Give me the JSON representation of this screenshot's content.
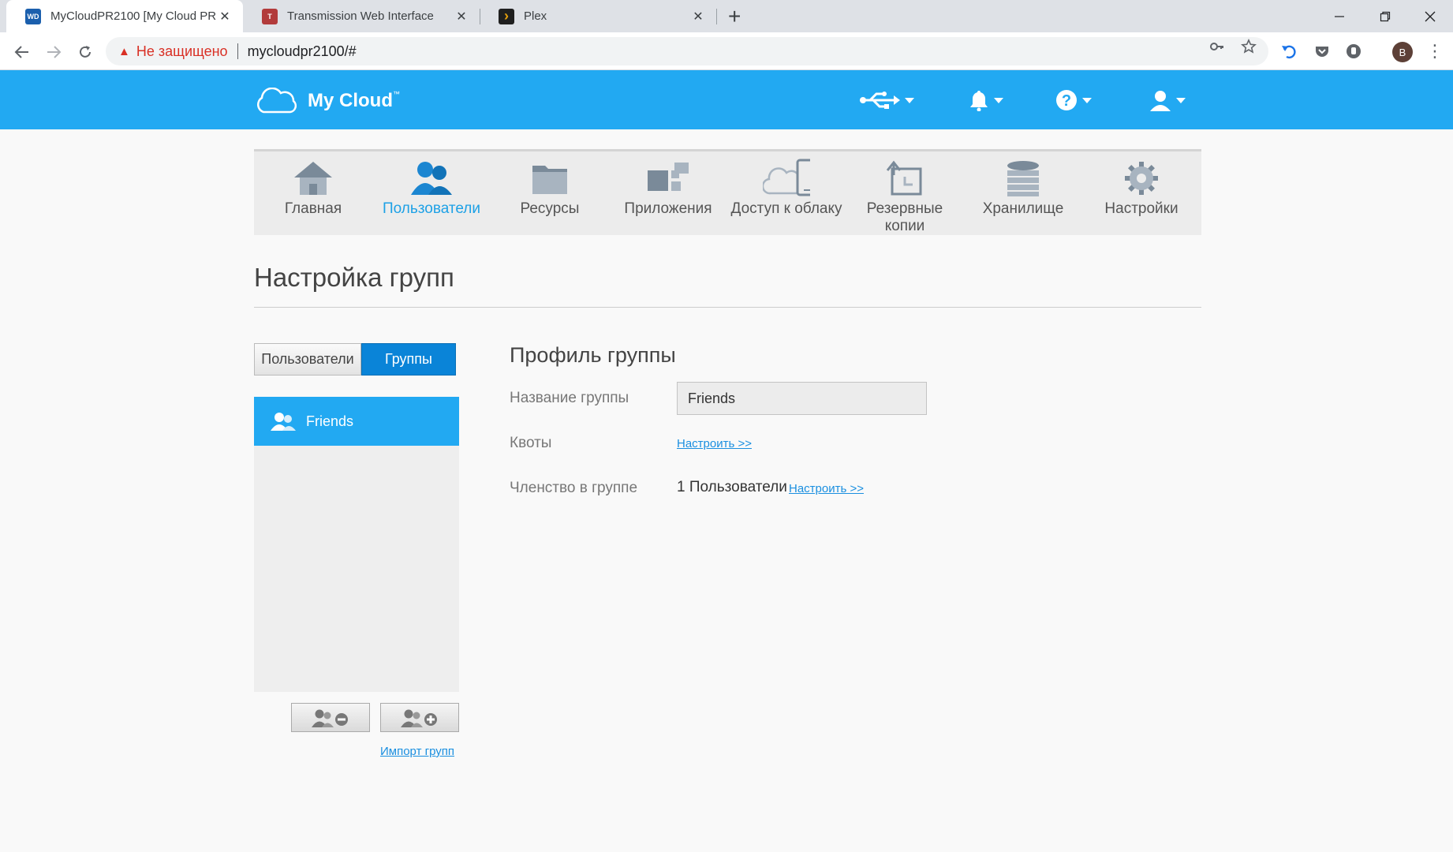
{
  "browser": {
    "tabs": [
      {
        "label": "MyCloudPR2100 [My Cloud PR2100]",
        "favicon": "WD"
      },
      {
        "label": "Transmission Web Interface",
        "favicon": "T"
      },
      {
        "label": "Plex",
        "favicon": "›"
      }
    ],
    "security_label": "Не защищено",
    "url": "mycloudpr2100/#",
    "profile_initial": "B"
  },
  "app": {
    "logo_text": "My Cloud",
    "logo_tm": "™",
    "brand_color": "#22a9f2"
  },
  "nav": [
    {
      "label": "Главная",
      "icon": "home-icon"
    },
    {
      "label": "Пользователи",
      "icon": "users-icon",
      "active": true
    },
    {
      "label": "Ресурсы",
      "icon": "folder-icon"
    },
    {
      "label": "Приложения",
      "icon": "apps-icon"
    },
    {
      "label": "Доступ к облаку",
      "icon": "cloud-device-icon"
    },
    {
      "label": "Резервные копии",
      "icon": "backup-icon"
    },
    {
      "label": "Хранилище",
      "icon": "storage-icon"
    },
    {
      "label": "Настройки",
      "icon": "gear-icon"
    }
  ],
  "page": {
    "title": "Настройка групп"
  },
  "toggle": {
    "users_label": "Пользователи",
    "groups_label": "Группы"
  },
  "groups": [
    {
      "name": "Friends"
    }
  ],
  "group_actions": {
    "import_label": "Импорт групп"
  },
  "profile": {
    "title": "Профиль группы",
    "name_label": "Название группы",
    "name_value": "Friends",
    "quota_label": "Квоты",
    "quota_link": "Настроить >>",
    "membership_label": "Членство в группе",
    "membership_value": "1 Пользователи",
    "membership_link": "Настроить >>"
  }
}
